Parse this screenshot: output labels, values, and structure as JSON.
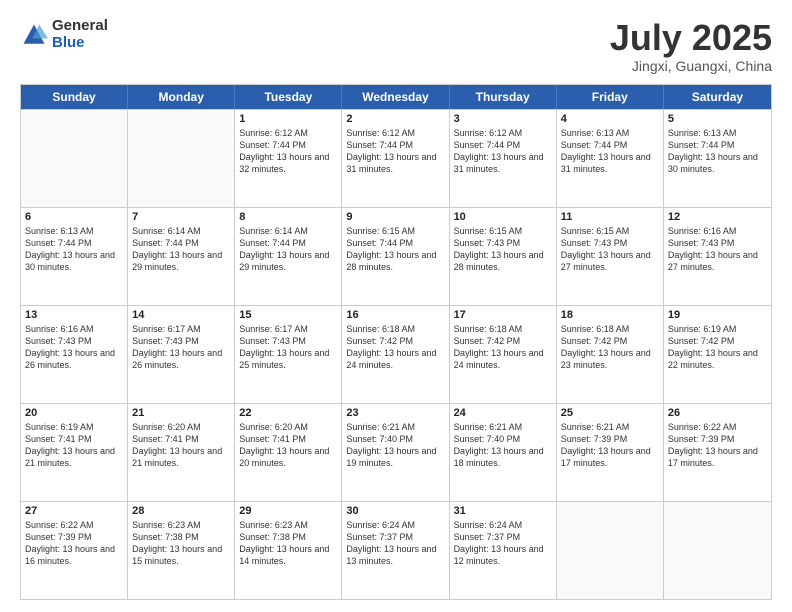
{
  "logo": {
    "general": "General",
    "blue": "Blue"
  },
  "header": {
    "month": "July 2025",
    "location": "Jingxi, Guangxi, China"
  },
  "weekdays": [
    "Sunday",
    "Monday",
    "Tuesday",
    "Wednesday",
    "Thursday",
    "Friday",
    "Saturday"
  ],
  "rows": [
    [
      {
        "day": "",
        "sunrise": "",
        "sunset": "",
        "daylight": ""
      },
      {
        "day": "",
        "sunrise": "",
        "sunset": "",
        "daylight": ""
      },
      {
        "day": "1",
        "sunrise": "Sunrise: 6:12 AM",
        "sunset": "Sunset: 7:44 PM",
        "daylight": "Daylight: 13 hours and 32 minutes."
      },
      {
        "day": "2",
        "sunrise": "Sunrise: 6:12 AM",
        "sunset": "Sunset: 7:44 PM",
        "daylight": "Daylight: 13 hours and 31 minutes."
      },
      {
        "day": "3",
        "sunrise": "Sunrise: 6:12 AM",
        "sunset": "Sunset: 7:44 PM",
        "daylight": "Daylight: 13 hours and 31 minutes."
      },
      {
        "day": "4",
        "sunrise": "Sunrise: 6:13 AM",
        "sunset": "Sunset: 7:44 PM",
        "daylight": "Daylight: 13 hours and 31 minutes."
      },
      {
        "day": "5",
        "sunrise": "Sunrise: 6:13 AM",
        "sunset": "Sunset: 7:44 PM",
        "daylight": "Daylight: 13 hours and 30 minutes."
      }
    ],
    [
      {
        "day": "6",
        "sunrise": "Sunrise: 6:13 AM",
        "sunset": "Sunset: 7:44 PM",
        "daylight": "Daylight: 13 hours and 30 minutes."
      },
      {
        "day": "7",
        "sunrise": "Sunrise: 6:14 AM",
        "sunset": "Sunset: 7:44 PM",
        "daylight": "Daylight: 13 hours and 29 minutes."
      },
      {
        "day": "8",
        "sunrise": "Sunrise: 6:14 AM",
        "sunset": "Sunset: 7:44 PM",
        "daylight": "Daylight: 13 hours and 29 minutes."
      },
      {
        "day": "9",
        "sunrise": "Sunrise: 6:15 AM",
        "sunset": "Sunset: 7:44 PM",
        "daylight": "Daylight: 13 hours and 28 minutes."
      },
      {
        "day": "10",
        "sunrise": "Sunrise: 6:15 AM",
        "sunset": "Sunset: 7:43 PM",
        "daylight": "Daylight: 13 hours and 28 minutes."
      },
      {
        "day": "11",
        "sunrise": "Sunrise: 6:15 AM",
        "sunset": "Sunset: 7:43 PM",
        "daylight": "Daylight: 13 hours and 27 minutes."
      },
      {
        "day": "12",
        "sunrise": "Sunrise: 6:16 AM",
        "sunset": "Sunset: 7:43 PM",
        "daylight": "Daylight: 13 hours and 27 minutes."
      }
    ],
    [
      {
        "day": "13",
        "sunrise": "Sunrise: 6:16 AM",
        "sunset": "Sunset: 7:43 PM",
        "daylight": "Daylight: 13 hours and 26 minutes."
      },
      {
        "day": "14",
        "sunrise": "Sunrise: 6:17 AM",
        "sunset": "Sunset: 7:43 PM",
        "daylight": "Daylight: 13 hours and 26 minutes."
      },
      {
        "day": "15",
        "sunrise": "Sunrise: 6:17 AM",
        "sunset": "Sunset: 7:43 PM",
        "daylight": "Daylight: 13 hours and 25 minutes."
      },
      {
        "day": "16",
        "sunrise": "Sunrise: 6:18 AM",
        "sunset": "Sunset: 7:42 PM",
        "daylight": "Daylight: 13 hours and 24 minutes."
      },
      {
        "day": "17",
        "sunrise": "Sunrise: 6:18 AM",
        "sunset": "Sunset: 7:42 PM",
        "daylight": "Daylight: 13 hours and 24 minutes."
      },
      {
        "day": "18",
        "sunrise": "Sunrise: 6:18 AM",
        "sunset": "Sunset: 7:42 PM",
        "daylight": "Daylight: 13 hours and 23 minutes."
      },
      {
        "day": "19",
        "sunrise": "Sunrise: 6:19 AM",
        "sunset": "Sunset: 7:42 PM",
        "daylight": "Daylight: 13 hours and 22 minutes."
      }
    ],
    [
      {
        "day": "20",
        "sunrise": "Sunrise: 6:19 AM",
        "sunset": "Sunset: 7:41 PM",
        "daylight": "Daylight: 13 hours and 21 minutes."
      },
      {
        "day": "21",
        "sunrise": "Sunrise: 6:20 AM",
        "sunset": "Sunset: 7:41 PM",
        "daylight": "Daylight: 13 hours and 21 minutes."
      },
      {
        "day": "22",
        "sunrise": "Sunrise: 6:20 AM",
        "sunset": "Sunset: 7:41 PM",
        "daylight": "Daylight: 13 hours and 20 minutes."
      },
      {
        "day": "23",
        "sunrise": "Sunrise: 6:21 AM",
        "sunset": "Sunset: 7:40 PM",
        "daylight": "Daylight: 13 hours and 19 minutes."
      },
      {
        "day": "24",
        "sunrise": "Sunrise: 6:21 AM",
        "sunset": "Sunset: 7:40 PM",
        "daylight": "Daylight: 13 hours and 18 minutes."
      },
      {
        "day": "25",
        "sunrise": "Sunrise: 6:21 AM",
        "sunset": "Sunset: 7:39 PM",
        "daylight": "Daylight: 13 hours and 17 minutes."
      },
      {
        "day": "26",
        "sunrise": "Sunrise: 6:22 AM",
        "sunset": "Sunset: 7:39 PM",
        "daylight": "Daylight: 13 hours and 17 minutes."
      }
    ],
    [
      {
        "day": "27",
        "sunrise": "Sunrise: 6:22 AM",
        "sunset": "Sunset: 7:39 PM",
        "daylight": "Daylight: 13 hours and 16 minutes."
      },
      {
        "day": "28",
        "sunrise": "Sunrise: 6:23 AM",
        "sunset": "Sunset: 7:38 PM",
        "daylight": "Daylight: 13 hours and 15 minutes."
      },
      {
        "day": "29",
        "sunrise": "Sunrise: 6:23 AM",
        "sunset": "Sunset: 7:38 PM",
        "daylight": "Daylight: 13 hours and 14 minutes."
      },
      {
        "day": "30",
        "sunrise": "Sunrise: 6:24 AM",
        "sunset": "Sunset: 7:37 PM",
        "daylight": "Daylight: 13 hours and 13 minutes."
      },
      {
        "day": "31",
        "sunrise": "Sunrise: 6:24 AM",
        "sunset": "Sunset: 7:37 PM",
        "daylight": "Daylight: 13 hours and 12 minutes."
      },
      {
        "day": "",
        "sunrise": "",
        "sunset": "",
        "daylight": ""
      },
      {
        "day": "",
        "sunrise": "",
        "sunset": "",
        "daylight": ""
      }
    ]
  ]
}
